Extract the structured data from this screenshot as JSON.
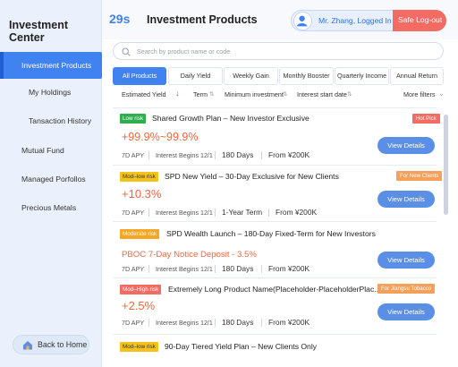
{
  "header": {
    "timer": "29s",
    "page_title": "Investment Products",
    "user": "Mr. Zhang, Logged In",
    "logout": "Safe Log-out"
  },
  "sidebar": {
    "title": "Investment Center",
    "items": [
      {
        "label": "Investment Products"
      },
      {
        "label": "My Holdings"
      },
      {
        "label": "Tansaction History"
      },
      {
        "label": "Mutual Fund"
      },
      {
        "label": "Managed Porfollos"
      },
      {
        "label": "Precious Metals"
      }
    ],
    "back_home": "Back to Home"
  },
  "search": {
    "placeholder": "Search by product name or code"
  },
  "tabs": [
    "All Products",
    "Daily Yield",
    "Weekly Gain",
    "Monthly Booster",
    "Quarterly Income",
    "Annual Return"
  ],
  "sort": {
    "estimated_yield": "Estimated Yield",
    "term": "Term",
    "minimum": "Minimum investment",
    "interest_date": "Interest start date",
    "more_filters": "More filters"
  },
  "colors": {
    "accent": "#3f82f0",
    "rate": "#f0673f",
    "logout": "#f36b63",
    "risk_low": "#2fae4f",
    "risk_mod_low": "#f5c21b",
    "risk_moderate": "#f5a623",
    "risk_mod_high": "#f36b63",
    "tag_hot": "#f36b63",
    "tag_new": "#f5a05a"
  },
  "products": [
    {
      "risk": "Low risk",
      "name": "Shared Growth Plan – New Investor Exclusive",
      "tag": "Hot Pick",
      "rate": "+99.9%~99.9%",
      "apy": "7D APY",
      "interest": "Interest Begins 12/1",
      "term": "180 Days",
      "min": "From ¥200K",
      "button": "View Details"
    },
    {
      "risk": "Mod–low risk",
      "name": "SPD New Yield – 30-Day Exclusive for New Clients",
      "tag": "For New Clients",
      "rate": "+10.3%",
      "apy": "7D APY",
      "interest": "Interest Begins 12/1",
      "term": "1-Year Term",
      "min": "From ¥200K",
      "button": "View Details"
    },
    {
      "risk": "Moderate risk",
      "name": "SPD Wealth Launch – 180-Day Fixed-Term for New Investors",
      "rate": "PBOC 7-Day Notice Deposit - 3.5%",
      "apy": "7D APY",
      "interest": "Interest Begins 12/1",
      "term": "180 Days",
      "min": "From ¥200K",
      "button": "View Details"
    },
    {
      "risk": "Mod–High risk",
      "name": "Extremely Long Product Name(Placeholder-PlaceholderPlac...",
      "tag": "For Jiangsu Tobacco",
      "rate": "+2.5%",
      "apy": "7D APY",
      "interest": "Interest Begins 12/1",
      "term": "180 Days",
      "min": "From ¥200K",
      "button": "View Details"
    },
    {
      "risk": "Mod–low risk",
      "name": "90-Day Tiered Yield Plan – New Clients Only"
    }
  ]
}
